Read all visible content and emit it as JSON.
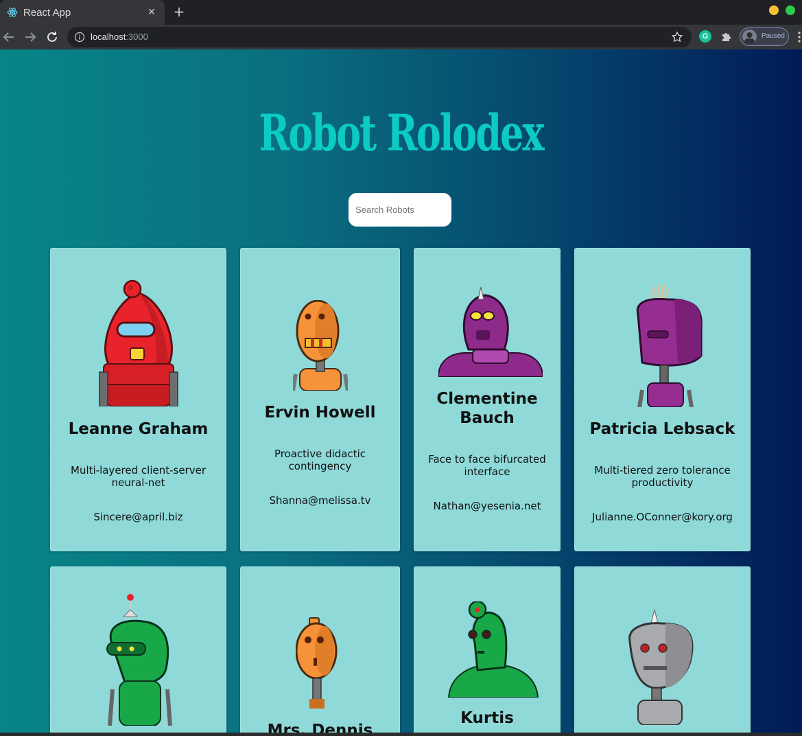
{
  "browser": {
    "tab_title": "React App",
    "new_tab_symbol": "+",
    "close_symbol": "✕",
    "url_host": "localhost",
    "url_port": ":3000",
    "profile_status": "Paused",
    "extension_letter": "G"
  },
  "app": {
    "title": "Robot Rolodex",
    "search_placeholder": "Search Robots",
    "title_color": "#0ccac4",
    "card_color": "#8fd9d9"
  },
  "robots": [
    {
      "name": "Leanne Graham",
      "phrase": "Multi-layered client-server neural-net",
      "email": "Sincere@april.biz",
      "color": "#e8232b"
    },
    {
      "name": "Ervin Howell",
      "phrase": "Proactive didactic contingency",
      "email": "Shanna@melissa.tv",
      "color": "#f5923a"
    },
    {
      "name": "Clementine Bauch",
      "phrase": "Face to face bifurcated interface",
      "email": "Nathan@yesenia.net",
      "color": "#8e2a8a"
    },
    {
      "name": "Patricia Lebsack",
      "phrase": "Multi-tiered zero tolerance productivity",
      "email": "Julianne.OConner@kory.org",
      "color": "#962d91"
    },
    {
      "name": "",
      "phrase": "",
      "email": "",
      "color": "#19a848"
    },
    {
      "name": "Mrs. Dennis",
      "phrase": "",
      "email": "",
      "color": "#f5923a"
    },
    {
      "name": "Kurtis",
      "phrase": "",
      "email": "",
      "color": "#19a848"
    },
    {
      "name": "",
      "phrase": "",
      "email": "",
      "color": "#a9aaad"
    }
  ]
}
